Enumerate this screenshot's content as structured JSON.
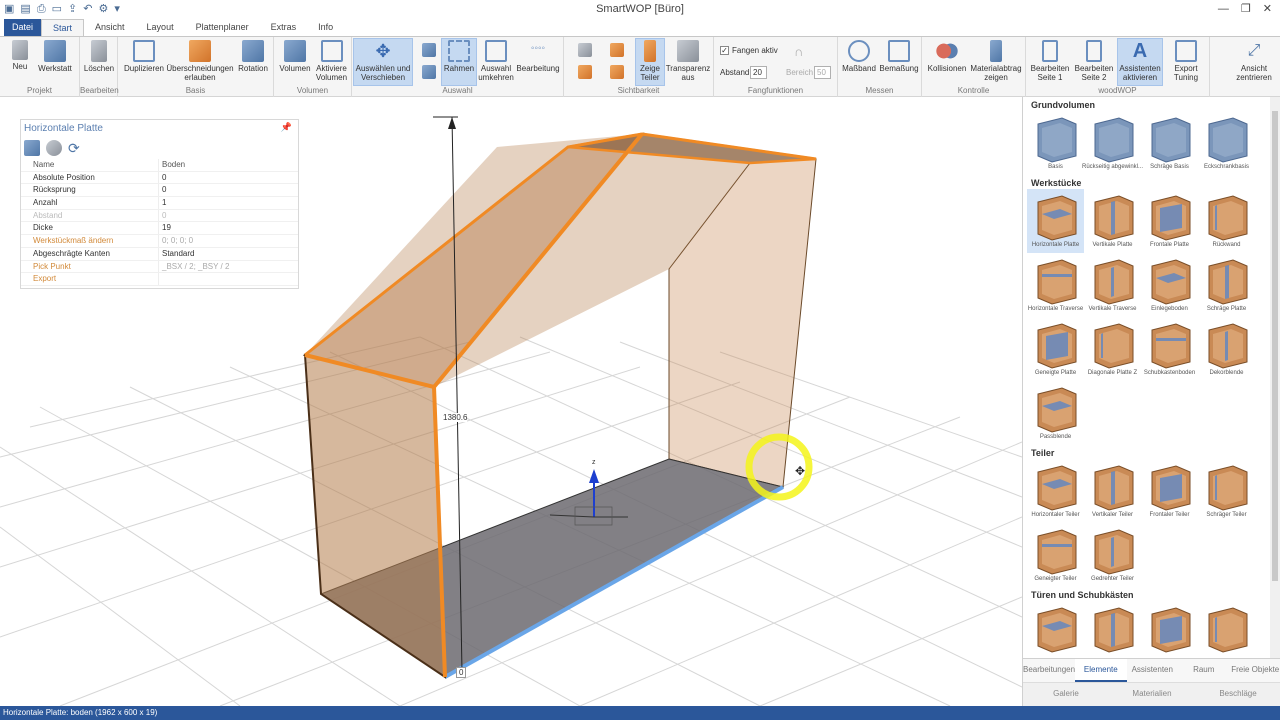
{
  "app": {
    "title": "SmartWOP [Büro]"
  },
  "menu": {
    "tabs": [
      "Datei",
      "Start",
      "Ansicht",
      "Layout",
      "Plattenplaner",
      "Extras",
      "Info"
    ],
    "active": "Start"
  },
  "ribbon": {
    "groups": {
      "projekt": "Projekt",
      "bearbeiten": "Bearbeiten",
      "basis": "Basis",
      "volumen": "Volumen",
      "auswahl": "Auswahl",
      "sichtbarkeit": "Sichtbarkeit",
      "fangfunktionen": "Fangfunktionen",
      "messen": "Messen",
      "kontrolle": "Kontrolle",
      "woodwop": "woodWOP"
    },
    "buttons": {
      "neu": "Neu",
      "werkstatt": "Werkstatt",
      "loeschen": "Löschen",
      "duplizieren": "Duplizieren",
      "ueberschneidungen": "Überschneidungen erlauben",
      "rotation": "Rotation",
      "volumen": "Volumen",
      "aktiviere_volumen": "Aktiviere Volumen",
      "auswaehlen": "Auswählen und Verschieben",
      "rahmen": "Rahmen",
      "auswahl_umkehren": "Auswahl umkehren",
      "bearbeitung": "Bearbeitung",
      "zeige_teiler": "Zeige Teiler",
      "transparenz": "Transparenz aus",
      "fangen_aktiv": "Fangen aktiv",
      "abstand_label": "Abstand",
      "abstand_value": "20",
      "bereich_label": "Bereich",
      "bereich_value": "50",
      "massband": "Maßband",
      "bemassung": "Bemaßung",
      "kollisionen": "Kollisionen",
      "materialabtrag": "Materialabtrag zeigen",
      "bearbeiten_seite1": "Bearbeiten Seite 1",
      "bearbeiten_seite2": "Bearbeiten Seite 2",
      "assistenten": "Assistenten aktivieren",
      "export_tuning": "Export Tuning",
      "ansicht_zentrieren": "Ansicht zentrieren"
    }
  },
  "props": {
    "title": "Horizontale Platte",
    "rows": [
      {
        "name": "Name",
        "value": "Boden",
        "style": "head"
      },
      {
        "name": "Absolute Position",
        "value": "0",
        "style": ""
      },
      {
        "name": "Rücksprung",
        "value": "0",
        "style": ""
      },
      {
        "name": "Anzahl",
        "value": "1",
        "style": ""
      },
      {
        "name": "Abstand",
        "value": "0",
        "style": "dis"
      },
      {
        "name": "Dicke",
        "value": "19",
        "style": ""
      },
      {
        "name": "Werkstückmaß ändern",
        "value": "0; 0; 0; 0",
        "style": "orange"
      },
      {
        "name": "Abgeschrägte Kanten",
        "value": "Standard",
        "style": ""
      },
      {
        "name": "Pick Punkt",
        "value": "_BSX / 2; _BSY / 2",
        "style": "orange"
      },
      {
        "name": "Export",
        "value": "",
        "style": "orange"
      }
    ]
  },
  "viewport": {
    "dimension_label": "1380.6",
    "origin_label": "0",
    "axis_label": "z"
  },
  "library": {
    "sections": {
      "grundvolumen": "Grundvolumen",
      "werkstuecke": "Werkstücke",
      "teiler": "Teiler",
      "tueren": "Türen und Schubkästen"
    },
    "grundvolumen": [
      "Basis",
      "Rückseitig abgewinkl...",
      "Schräge Basis",
      "Eckschrankbasis"
    ],
    "werkstuecke": [
      "Horizontale Platte",
      "Vertikale Platte",
      "Frontale Platte",
      "Rückwand",
      "Horizontale Traverse",
      "Vertikale Traverse",
      "Einlegeboden",
      "Schräge Platte",
      "Geneigte Platte",
      "Diagonale Platte Z",
      "Schubkastenboden",
      "Dekorblende",
      "Passblende"
    ],
    "teiler": [
      "Horizontaler Teiler",
      "Vertikaler Teiler",
      "Frontaler Teiler",
      "Schräger Teiler",
      "Geneigter Teiler",
      "Gedrehter Teiler"
    ],
    "tueren": [
      "",
      "",
      "",
      ""
    ]
  },
  "rtabs": [
    "Bearbeitungen",
    "Elemente",
    "Assistenten",
    "Raum",
    "Freie Objekte"
  ],
  "rtabs_active": "Elemente",
  "rtabs2": [
    "Galerie",
    "Materialien",
    "Beschläge"
  ],
  "status": "Horizontale Platte: boden (1962 x 600 x 19)",
  "colors": {
    "accent": "#2b579a",
    "orange": "#f08a24",
    "wood": "#c98a55",
    "blue_edge": "#6aa6e8"
  }
}
